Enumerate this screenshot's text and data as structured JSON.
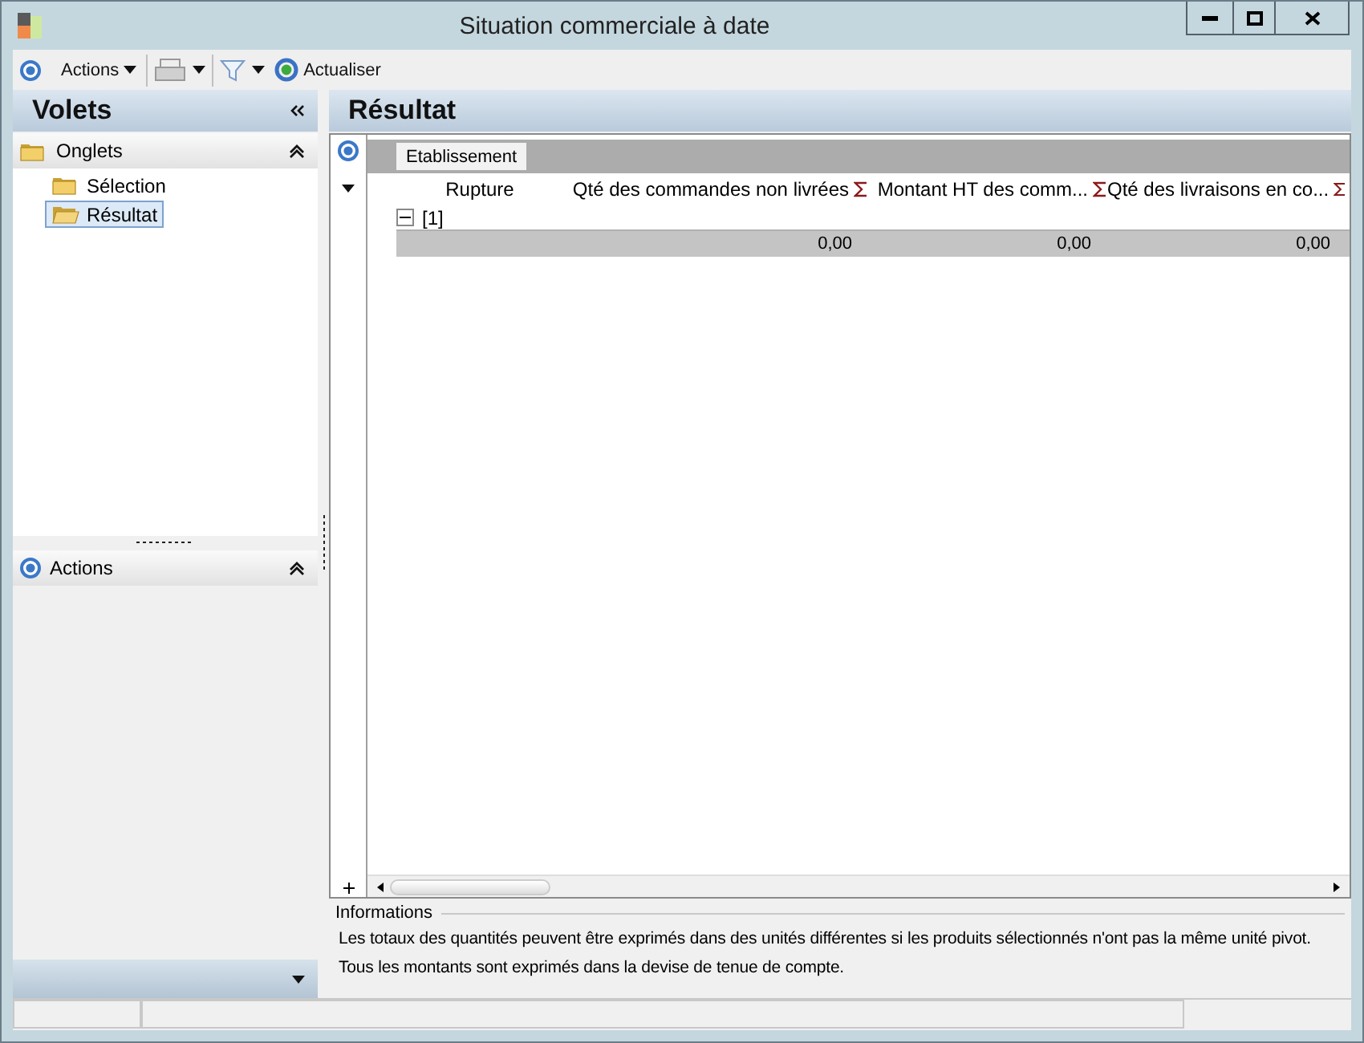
{
  "window": {
    "title": "Situation commerciale à date"
  },
  "toolbar": {
    "actions_label": "Actions",
    "refresh_label": "Actualiser"
  },
  "left_panel": {
    "title": "Volets",
    "onglets": {
      "title": "Onglets",
      "expanded": true,
      "items": [
        {
          "label": "Sélection",
          "selected": false
        },
        {
          "label": "Résultat",
          "selected": true
        }
      ]
    },
    "actions": {
      "title": "Actions",
      "expanded": true
    }
  },
  "result": {
    "title": "Résultat",
    "group_band": [
      "Etablissement"
    ],
    "columns": [
      {
        "label": "Rupture",
        "sum": false
      },
      {
        "label": "Qté des commandes non livrées",
        "sum": true
      },
      {
        "label": "Montant HT des comm...",
        "sum": true
      },
      {
        "label": "Qté des livraisons en co...",
        "sum": true
      }
    ],
    "groups": [
      {
        "label": "[1]",
        "expanded": true,
        "totals": [
          "0,00",
          "0,00",
          "0,00"
        ]
      }
    ]
  },
  "info": {
    "title": "Informations",
    "lines": [
      "Les totaux des quantités peuvent être exprimés dans des unités différentes si les produits sélectionnés n'ont pas la même unité pivot.",
      "Tous les montants sont exprimés dans la devise de tenue de compte."
    ]
  }
}
